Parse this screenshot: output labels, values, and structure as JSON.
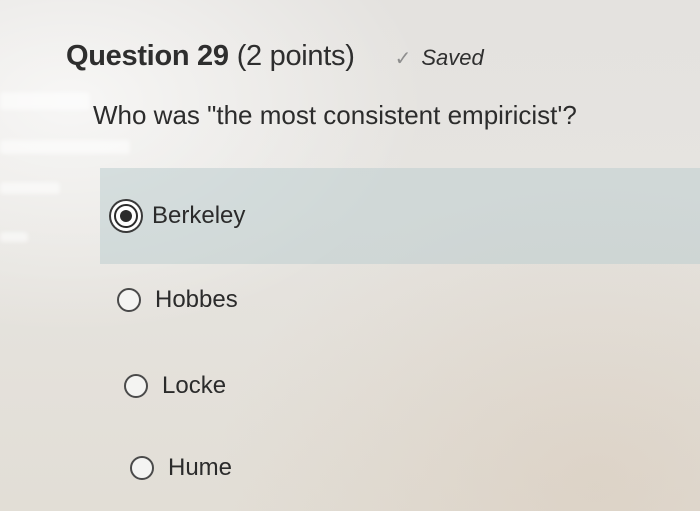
{
  "question": {
    "title": "Question 29",
    "points": "(2 points)",
    "status": "Saved",
    "prompt": "Who was \"the most consistent empiricist'?"
  },
  "options": [
    {
      "label": "Berkeley",
      "selected": true
    },
    {
      "label": "Hobbes",
      "selected": false
    },
    {
      "label": "Locke",
      "selected": false
    },
    {
      "label": "Hume",
      "selected": false
    }
  ],
  "icons": {
    "status": "checkmark-icon"
  },
  "colors": {
    "selected_row": "#bfd0d2",
    "text": "#2b2b2b",
    "check": "#8e8e8e"
  }
}
